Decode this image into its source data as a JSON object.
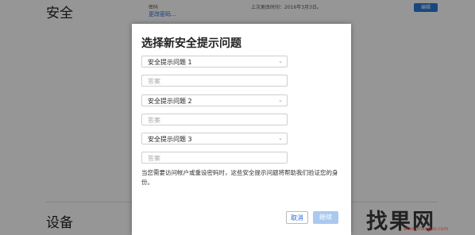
{
  "background": {
    "sections": [
      {
        "title": "安全"
      },
      {
        "title": "设备"
      }
    ],
    "password_label": "密码",
    "change_password_link": "更改密码...",
    "last_changed_text": "上次更改时间：2016年3月3日。",
    "edit_button": "编辑"
  },
  "modal": {
    "title": "选择新安全提示问题",
    "questions": [
      {
        "label": "安全提示问题 1",
        "answer_placeholder": "答案"
      },
      {
        "label": "安全提示问题 2",
        "answer_placeholder": "答案"
      },
      {
        "label": "安全提示问题 3",
        "answer_placeholder": "答案"
      }
    ],
    "help_text": "当您需要访问帐户或重设密码时，这些安全提示问题将帮助我们验证您的身份。",
    "cancel_label": "取消",
    "continue_label": "继续"
  },
  "watermark": {
    "text": "找果网",
    "sub": "www.zhaoguo.com"
  },
  "colors": {
    "accent": "#2a6ad3",
    "disabled_button": "#a9c9ef"
  }
}
